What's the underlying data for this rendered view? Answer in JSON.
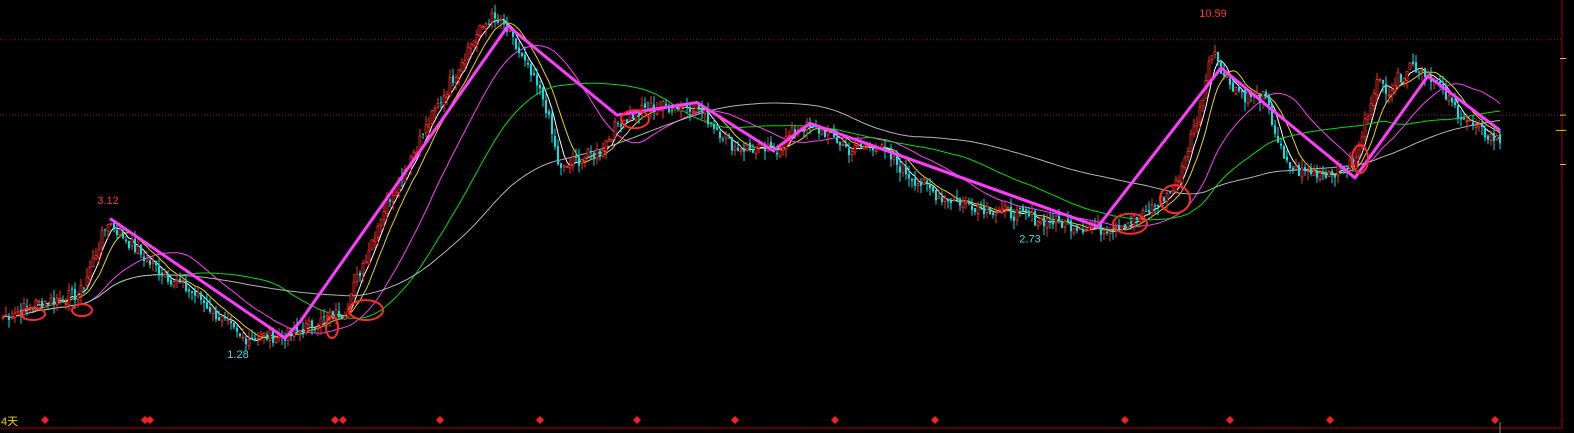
{
  "chart_data": {
    "type": "candlestick",
    "period_label": "4天",
    "ylim": [
      0.8,
      12.0
    ],
    "reference_levels": [
      9.5,
      5.8
    ],
    "annotations": [
      {
        "text": "3.12",
        "x": 108,
        "price": 3.12,
        "kind": "high"
      },
      {
        "text": "1.28",
        "x": 238,
        "price": 1.28,
        "kind": "low"
      },
      {
        "text": "2.73",
        "x": 1030,
        "price": 2.73,
        "kind": "low"
      },
      {
        "text": "10.59",
        "x": 1213,
        "price": 10.59,
        "kind": "high"
      }
    ],
    "candles": {
      "x_start": 3,
      "x_end": 1500,
      "step": 3,
      "anchors": [
        [
          3,
          1.55
        ],
        [
          40,
          1.7
        ],
        [
          80,
          1.8
        ],
        [
          108,
          2.9
        ],
        [
          150,
          2.2
        ],
        [
          200,
          1.75
        ],
        [
          240,
          1.35
        ],
        [
          290,
          1.38
        ],
        [
          330,
          1.55
        ],
        [
          345,
          1.62
        ],
        [
          385,
          3.2
        ],
        [
          430,
          5.6
        ],
        [
          470,
          9.2
        ],
        [
          490,
          11.0
        ],
        [
          505,
          10.3
        ],
        [
          520,
          8.6
        ],
        [
          545,
          6.3
        ],
        [
          560,
          4.0
        ],
        [
          575,
          4.3
        ],
        [
          600,
          4.6
        ],
        [
          620,
          5.6
        ],
        [
          650,
          6.1
        ],
        [
          695,
          6.2
        ],
        [
          735,
          4.7
        ],
        [
          775,
          4.6
        ],
        [
          800,
          5.4
        ],
        [
          825,
          5.2
        ],
        [
          850,
          4.6
        ],
        [
          875,
          4.8
        ],
        [
          910,
          3.9
        ],
        [
          940,
          3.4
        ],
        [
          1000,
          3.1
        ],
        [
          1035,
          2.95
        ],
        [
          1100,
          2.75
        ],
        [
          1140,
          2.95
        ],
        [
          1175,
          3.6
        ],
        [
          1200,
          6.0
        ],
        [
          1213,
          9.2
        ],
        [
          1225,
          7.4
        ],
        [
          1245,
          6.6
        ],
        [
          1265,
          6.5
        ],
        [
          1285,
          4.2
        ],
        [
          1300,
          4.0
        ],
        [
          1330,
          4.0
        ],
        [
          1355,
          4.2
        ],
        [
          1375,
          7.2
        ],
        [
          1390,
          6.9
        ],
        [
          1410,
          8.1
        ],
        [
          1430,
          7.6
        ],
        [
          1450,
          6.3
        ],
        [
          1475,
          5.3
        ],
        [
          1500,
          4.9
        ]
      ]
    },
    "trend_lines": [
      {
        "color": "#ff3cff",
        "points": [
          [
            110,
            2.95
          ],
          [
            285,
            1.35
          ],
          [
            300,
            1.5
          ],
          [
            508,
            10.4
          ],
          [
            617,
            5.8
          ],
          [
            697,
            6.3
          ],
          [
            773,
            4.6
          ],
          [
            810,
            5.5
          ],
          [
            1098,
            2.8
          ],
          [
            1221,
            7.9
          ],
          [
            1355,
            3.85
          ],
          [
            1428,
            7.5
          ],
          [
            1500,
            5.25
          ]
        ]
      }
    ],
    "moving_averages": [
      {
        "color": "#ffffff",
        "window": 5
      },
      {
        "color": "#e6d800",
        "window": 10
      },
      {
        "color": "#ff3cff",
        "window": 30
      },
      {
        "color": "#00e000",
        "window": 60
      },
      {
        "color": "#b4b4b4",
        "window": 120
      }
    ],
    "highlight_circles": [
      {
        "x": 33,
        "price": 1.58,
        "rx": 12,
        "ry": 6
      },
      {
        "x": 82,
        "price": 1.62,
        "rx": 10,
        "ry": 6
      },
      {
        "x": 332,
        "price": 1.45,
        "rx": 6,
        "ry": 11
      },
      {
        "x": 366,
        "price": 1.62,
        "rx": 17,
        "ry": 10
      },
      {
        "x": 635,
        "price": 5.65,
        "rx": 14,
        "ry": 9
      },
      {
        "x": 1130,
        "price": 2.85,
        "rx": 17,
        "ry": 10
      },
      {
        "x": 1175,
        "price": 3.35,
        "rx": 15,
        "ry": 14
      },
      {
        "x": 1360,
        "price": 4.35,
        "rx": 8,
        "ry": 14
      }
    ],
    "signal_markers": {
      "color": "#ff1e1e",
      "x_positions": [
        45,
        145,
        150,
        335,
        343,
        440,
        540,
        637,
        735,
        835,
        935,
        1125,
        1230,
        1330,
        1495
      ]
    },
    "colors": {
      "up": "#ff3030",
      "down": "#00e5e5",
      "trend": "#ff3cff",
      "reference": "#a01010",
      "high_label": "#ff3333",
      "low_label": "#38e0e0",
      "period_label": "#e6d800",
      "axis": "#c00000",
      "right_scale": "#e6c200"
    }
  }
}
